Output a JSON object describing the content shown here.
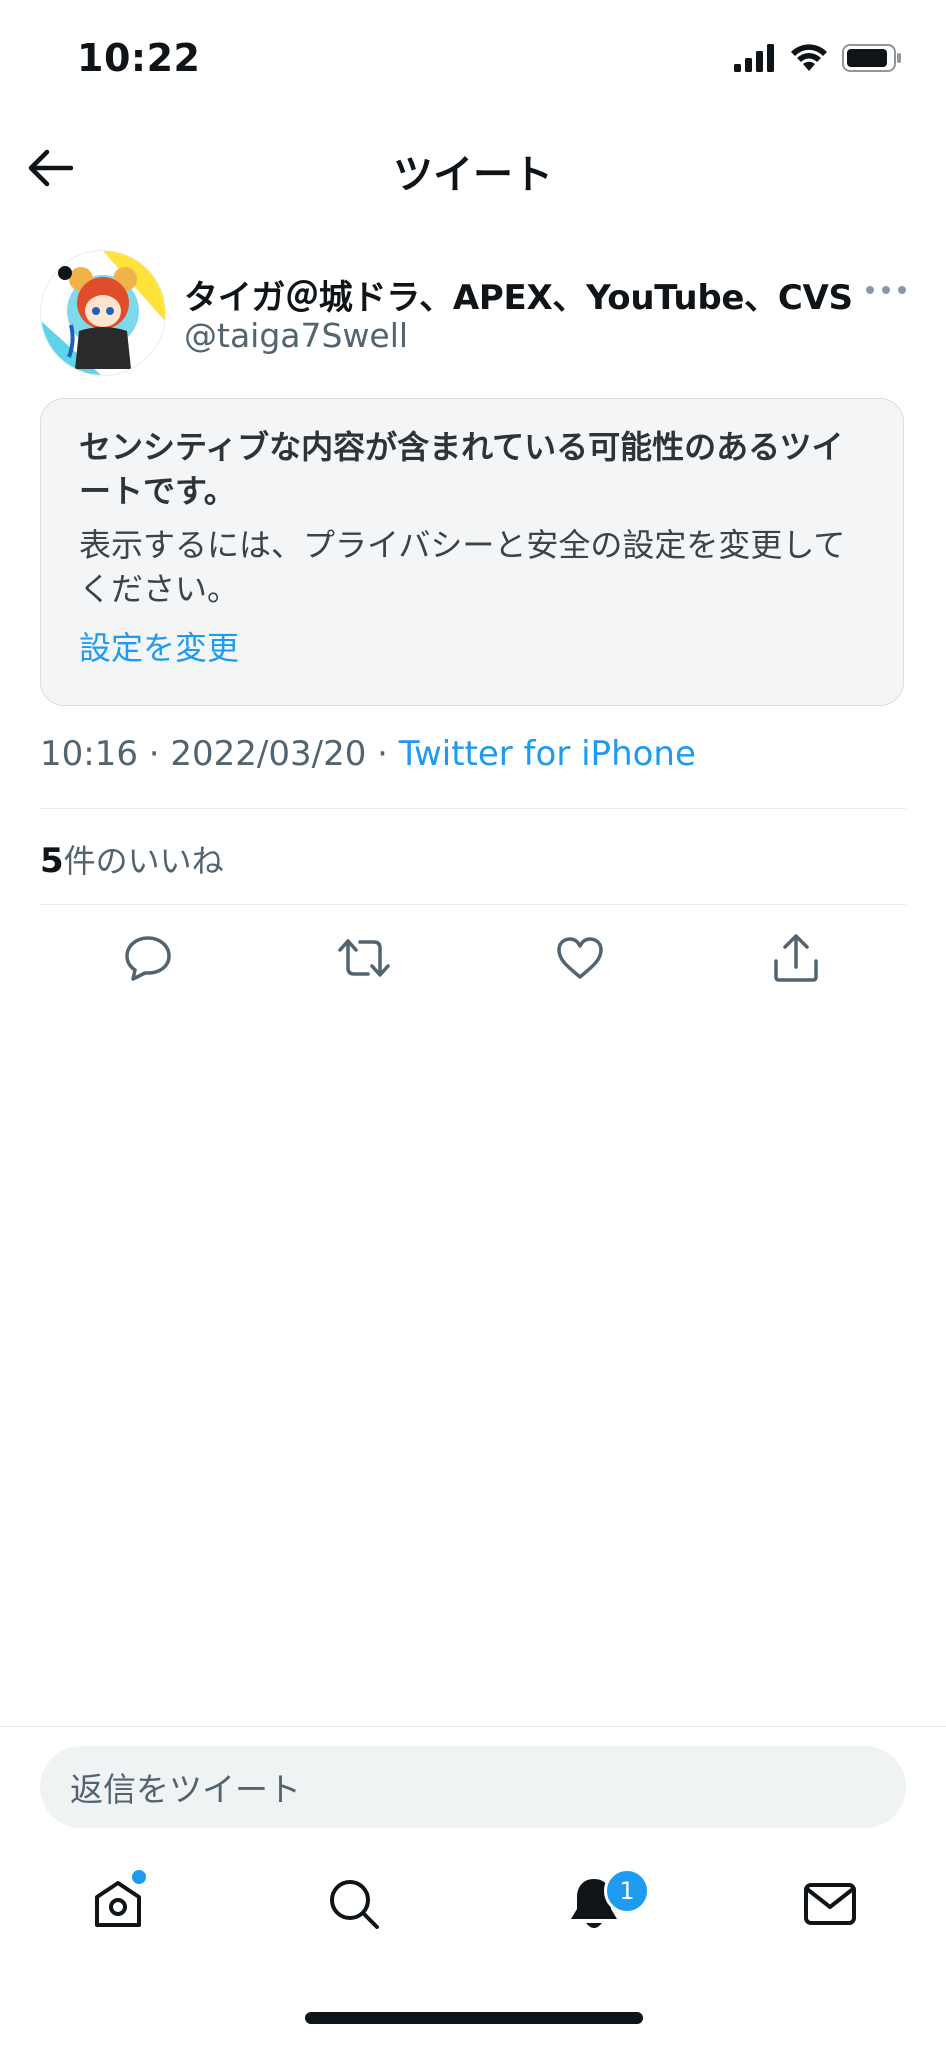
{
  "status_bar": {
    "time": "10:22"
  },
  "header": {
    "title": "ツイート",
    "back_icon": "arrow-left-icon"
  },
  "tweet": {
    "author": {
      "display_name": "タイガ＠城ドラ、APEX、YouTube、CVS",
      "handle": "@taiga7Swell"
    },
    "sensitive_notice": {
      "heading": "センシティブな内容が含まれている可能性のあるツイートです。",
      "body": "表示するには、プライバシーと安全の設定を変更してください。",
      "link": "設定を変更"
    },
    "timestamp": "10:16 · 2022/03/20 · ",
    "source": "Twitter for iPhone",
    "likes_count": "5",
    "likes_label": "件のいいね"
  },
  "actions": [
    "reply-icon",
    "retweet-icon",
    "like-icon",
    "share-icon"
  ],
  "reply_bar": {
    "placeholder": "返信をツイート"
  },
  "bottom_nav": {
    "items": [
      "home-icon",
      "search-icon",
      "notifications-icon",
      "messages-icon"
    ],
    "notification_badge": "1"
  },
  "colors": {
    "accent": "#1d9bf0",
    "text": "#0f1419",
    "secondary": "#536471"
  }
}
